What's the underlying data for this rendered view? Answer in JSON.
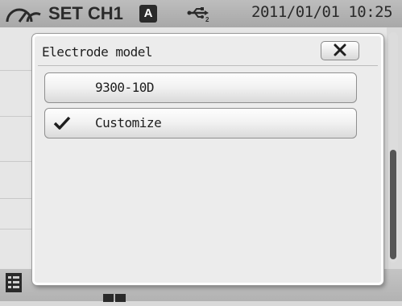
{
  "status_bar": {
    "title": "SET CH1",
    "mode_badge": "A",
    "datetime": "2011/01/01 10:25",
    "icons": [
      "gauge-icon",
      "usb-icon"
    ]
  },
  "dialog": {
    "title": "Electrode model",
    "close_icon": "close-icon",
    "options": [
      {
        "label": "9300-10D",
        "selected": false
      },
      {
        "label": "Customize",
        "selected": true,
        "icon": "check-icon"
      }
    ]
  },
  "bottom_bar": {
    "icons": [
      "list-icon",
      "book-icon"
    ]
  },
  "colors": {
    "background": "#d9d9d9",
    "status_bar": "#b0b0b0",
    "dialog": "#ececec",
    "text": "#1e1e1e"
  }
}
